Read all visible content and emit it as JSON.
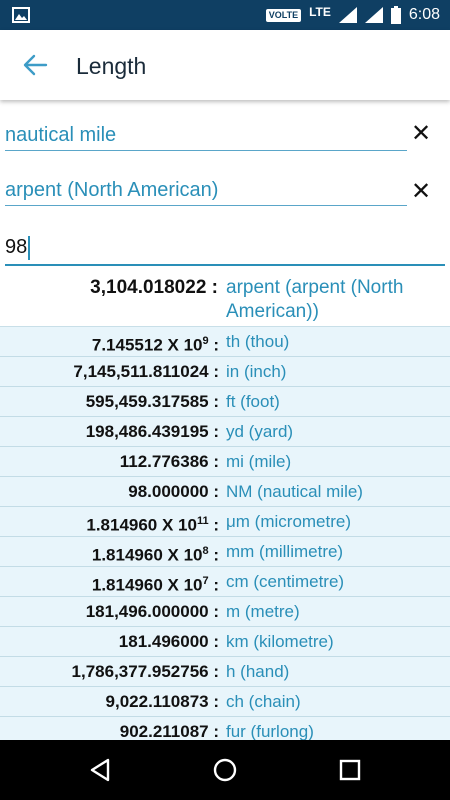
{
  "status": {
    "volte": "VOLTE",
    "network": "LTE",
    "time": "6:08"
  },
  "header": {
    "title": "Length"
  },
  "inputs": {
    "from_unit": "nautical mile",
    "to_unit": "arpent (North American)",
    "value": "98",
    "clear_glyph": "✕"
  },
  "main_result": {
    "value": "3,104.018022 :",
    "unit": "arpent (arpent (North American))"
  },
  "rows": [
    {
      "num": "7.145512 X 10",
      "exp": "9",
      "unit": "th (thou)"
    },
    {
      "num": "7,145,511.811024 :",
      "unit": "in (inch)"
    },
    {
      "num": "595,459.317585 :",
      "unit": "ft (foot)"
    },
    {
      "num": "198,486.439195 :",
      "unit": "yd (yard)"
    },
    {
      "num": "112.776386 :",
      "unit": "mi (mile)"
    },
    {
      "num": "98.000000 :",
      "unit": "NM (nautical mile)"
    },
    {
      "num": "1.814960 X 10",
      "exp": "11",
      "unit": "μm (micrometre)"
    },
    {
      "num": "1.814960 X 10",
      "exp": "8",
      "unit": "mm (millimetre)"
    },
    {
      "num": "1.814960 X 10",
      "exp": "7",
      "unit": "cm (centimetre)"
    },
    {
      "num": "181,496.000000 :",
      "unit": "m (metre)"
    },
    {
      "num": "181.496000 :",
      "unit": "km (kilometre)"
    },
    {
      "num": "1,786,377.952756 :",
      "unit": "h (hand)"
    },
    {
      "num": "9,022.110873 :",
      "unit": "ch (chain)"
    },
    {
      "num": "902.211087 :",
      "unit": "fur (furlong)"
    }
  ],
  "colors": {
    "status_bar": "#0f3f63",
    "accent": "#2a8fb8",
    "list_bg": "#e8f5fb"
  },
  "icons": [
    "image-icon",
    "signal-icon",
    "battery-icon",
    "back-arrow-icon",
    "clear-icon",
    "nav-back-icon",
    "nav-home-icon",
    "nav-recents-icon"
  ]
}
